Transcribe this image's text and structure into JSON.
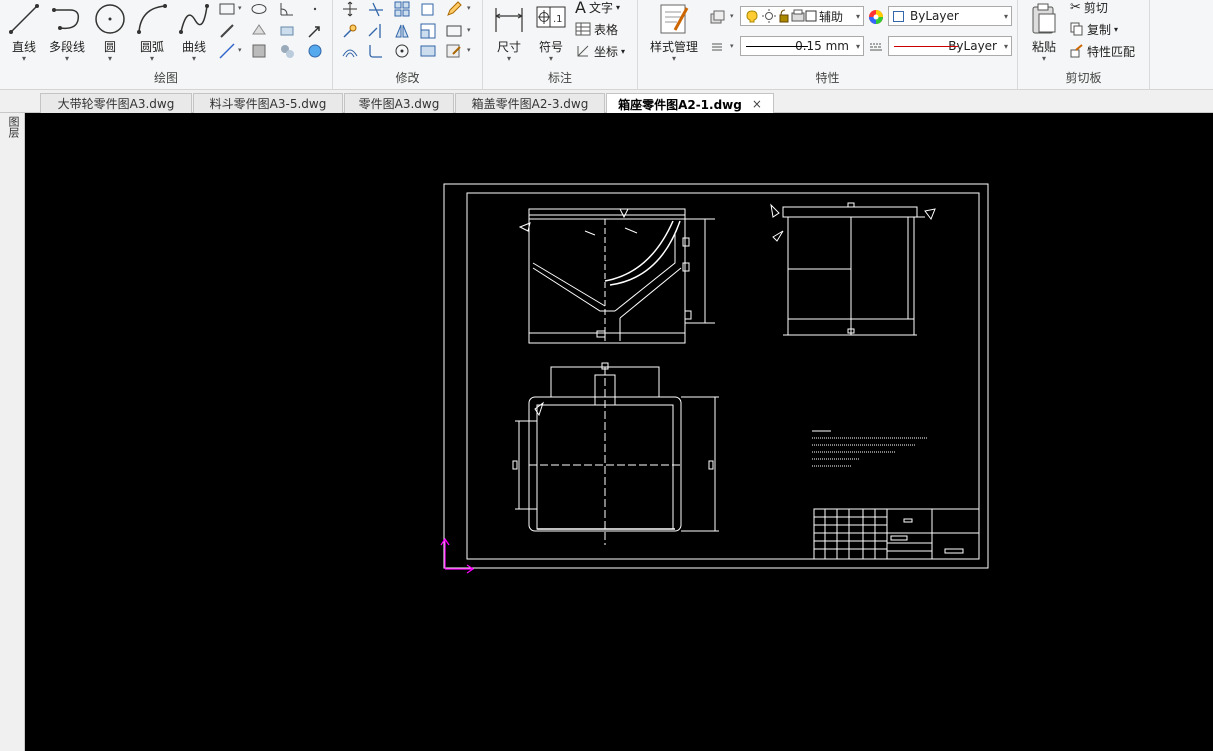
{
  "ribbon": {
    "draw": {
      "label": "绘图",
      "line": "直线",
      "polyline": "多段线",
      "circle": "圆",
      "arc": "圆弧",
      "curve": "曲线"
    },
    "modify": {
      "label": "修改"
    },
    "annotate": {
      "label": "标注",
      "dimension": "尺寸",
      "symbol": "符号",
      "text": "文字",
      "table": "表格",
      "coord": "坐标"
    },
    "properties": {
      "label": "特性",
      "style_manager": "样式管理",
      "layer_name": "辅助",
      "color": "ByLayer",
      "lineweight": "0.15 mm",
      "linetype": "ByLayer"
    },
    "clipboard": {
      "label": "剪切板",
      "paste": "粘贴",
      "cut": "剪切",
      "copy": "复制",
      "match": "特性匹配"
    }
  },
  "tabs": [
    "大带轮零件图A3.dwg",
    "料斗零件图A3-5.dwg",
    "零件图A3.dwg",
    "箱盖零件图A2-3.dwg",
    "箱座零件图A2-1.dwg"
  ],
  "close_glyph": "×",
  "sidebar": {
    "label": "图层"
  },
  "colors": {
    "accent_ucs": "#ff00ff",
    "canvas_bg": "#000000",
    "drawing_lines": "#ffffff",
    "linetype_red": "#cc0000"
  }
}
